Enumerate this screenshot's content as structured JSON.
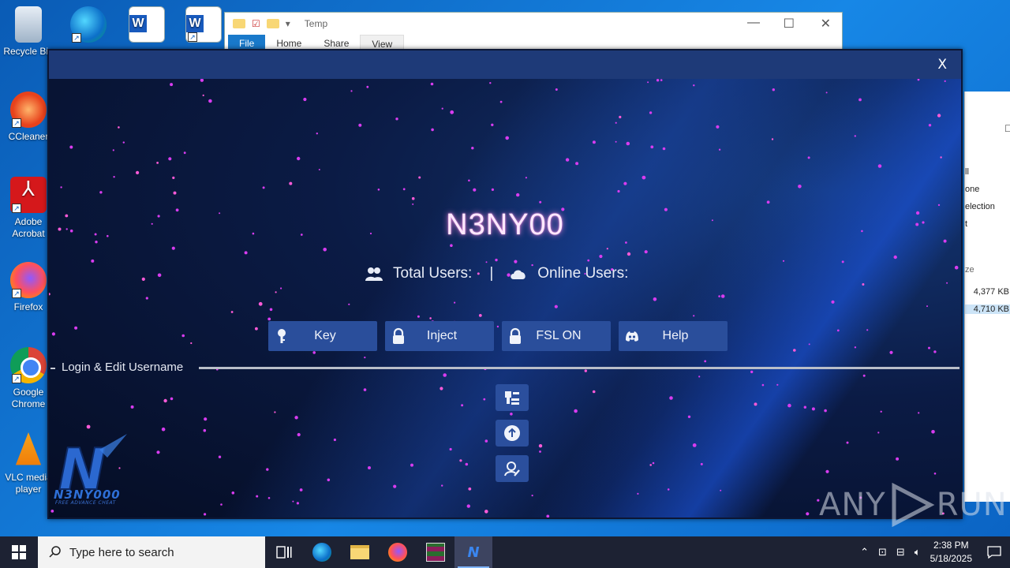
{
  "desktop": {
    "icons": [
      {
        "label": "Recycle Bin",
        "icon": "recycle-bin-icon"
      },
      {
        "label": "",
        "icon": "edge-icon"
      },
      {
        "label": "",
        "icon": "word-icon"
      },
      {
        "label": "",
        "icon": "word-icon"
      },
      {
        "label": "CCleaner",
        "icon": "ccleaner-icon"
      },
      {
        "label": "Adobe Acrobat",
        "icon": "adobe-acrobat-icon"
      },
      {
        "label": "Firefox",
        "icon": "firefox-icon"
      },
      {
        "label": "Google Chrome",
        "icon": "chrome-icon"
      },
      {
        "label": "VLC media player",
        "icon": "vlc-icon"
      }
    ]
  },
  "explorer": {
    "title": "Temp",
    "ribbon": [
      "File",
      "Home",
      "Share",
      "View"
    ],
    "side_items": [
      "ll",
      "one",
      "election",
      "t"
    ],
    "size_header": "ze",
    "sizes": [
      "4,377 KB",
      "4,710 KB"
    ]
  },
  "app": {
    "close_label": "X",
    "title": "N3NY00",
    "stats": {
      "total_users_label": "Total Users:",
      "separator": "|",
      "online_users_label": "Online Users:"
    },
    "buttons": [
      {
        "label": "Key",
        "icon": "key-icon"
      },
      {
        "label": "Inject",
        "icon": "lock-icon"
      },
      {
        "label": "FSL ON",
        "icon": "lock-icon"
      },
      {
        "label": "Help",
        "icon": "discord-icon"
      }
    ],
    "section_label": "Login & Edit Username",
    "side_buttons": [
      "settings-icon",
      "upload-icon",
      "user-edit-icon"
    ],
    "logo_text": "N3NY000",
    "logo_sub": "FREE ADVANCE CHEAT",
    "logo_letter": "N"
  },
  "watermark": {
    "left": "ANY",
    "right": "RUN"
  },
  "taskbar": {
    "search_placeholder": "Type here to search",
    "time": "2:38 PM",
    "date": "5/18/2025"
  }
}
